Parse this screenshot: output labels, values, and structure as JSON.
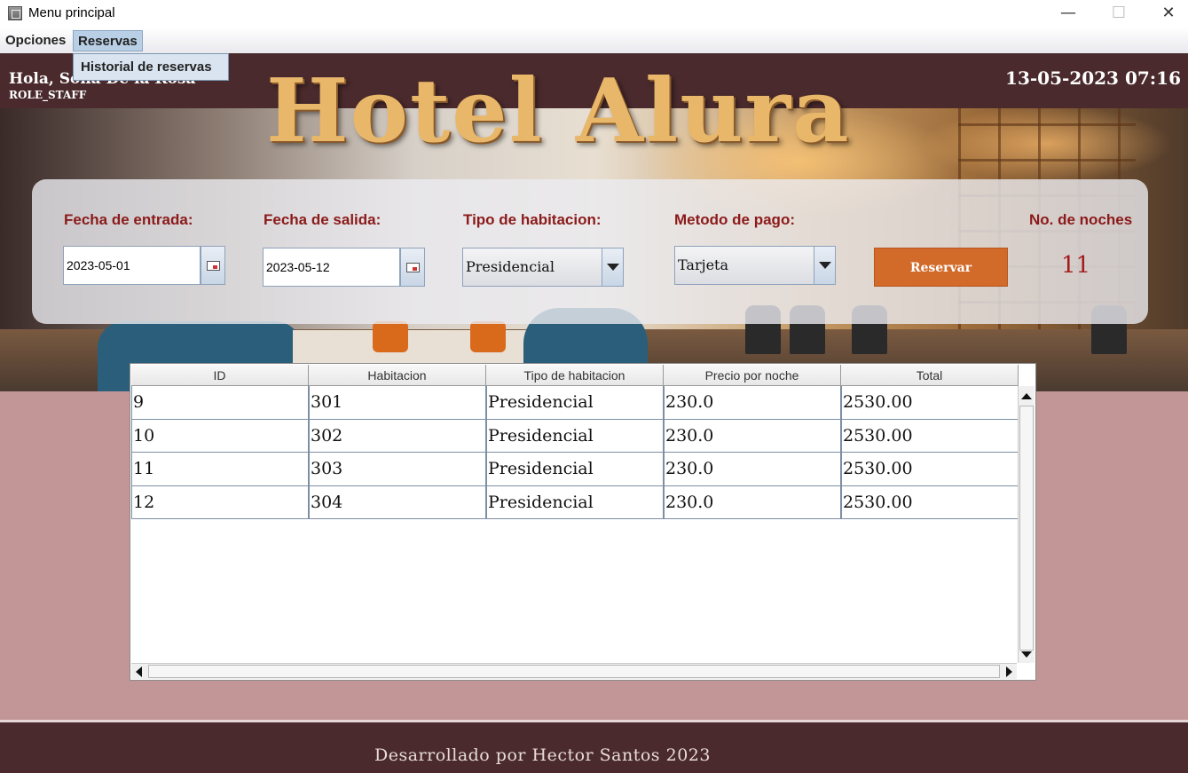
{
  "window": {
    "title": "Menu principal",
    "minimize": "—",
    "maximize": "☐",
    "close": "✕"
  },
  "menubar": {
    "items": [
      {
        "label": "Opciones"
      },
      {
        "label": "Reservas"
      }
    ],
    "dropdown": {
      "label": "Historial de reservas"
    }
  },
  "header": {
    "greeting": "Hola, Sofia De la Rosa",
    "role": "ROLE_STAFF",
    "datetime": "13-05-2023 07:16",
    "logo": "Hotel Alura"
  },
  "form": {
    "entrada": {
      "label": "Fecha de entrada:",
      "value": "2023-05-01"
    },
    "salida": {
      "label": "Fecha de salida:",
      "value": "2023-05-12"
    },
    "tipo": {
      "label": "Tipo de habitacion:",
      "value": "Presidencial"
    },
    "pago": {
      "label": "Metodo de pago:",
      "value": "Tarjeta"
    },
    "reservar_label": "Reservar",
    "noches": {
      "label": "No. de noches",
      "value": "11"
    }
  },
  "table": {
    "columns": [
      "ID",
      "Habitacion",
      "Tipo de habitacion",
      "Precio por noche",
      "Total"
    ],
    "rows": [
      [
        "9",
        "301",
        "Presidencial",
        "230.0",
        "2530.00"
      ],
      [
        "10",
        "302",
        "Presidencial",
        "230.0",
        "2530.00"
      ],
      [
        "11",
        "303",
        "Presidencial",
        "230.0",
        "2530.00"
      ],
      [
        "12",
        "304",
        "Presidencial",
        "230.0",
        "2530.00"
      ]
    ]
  },
  "footer": {
    "text": "Desarrollado por Hector Santos 2023"
  },
  "colors": {
    "header_bg": "#4a2a2d",
    "body_bg": "#c29597",
    "accent": "#d26a2a",
    "label": "#8b1a1a"
  }
}
